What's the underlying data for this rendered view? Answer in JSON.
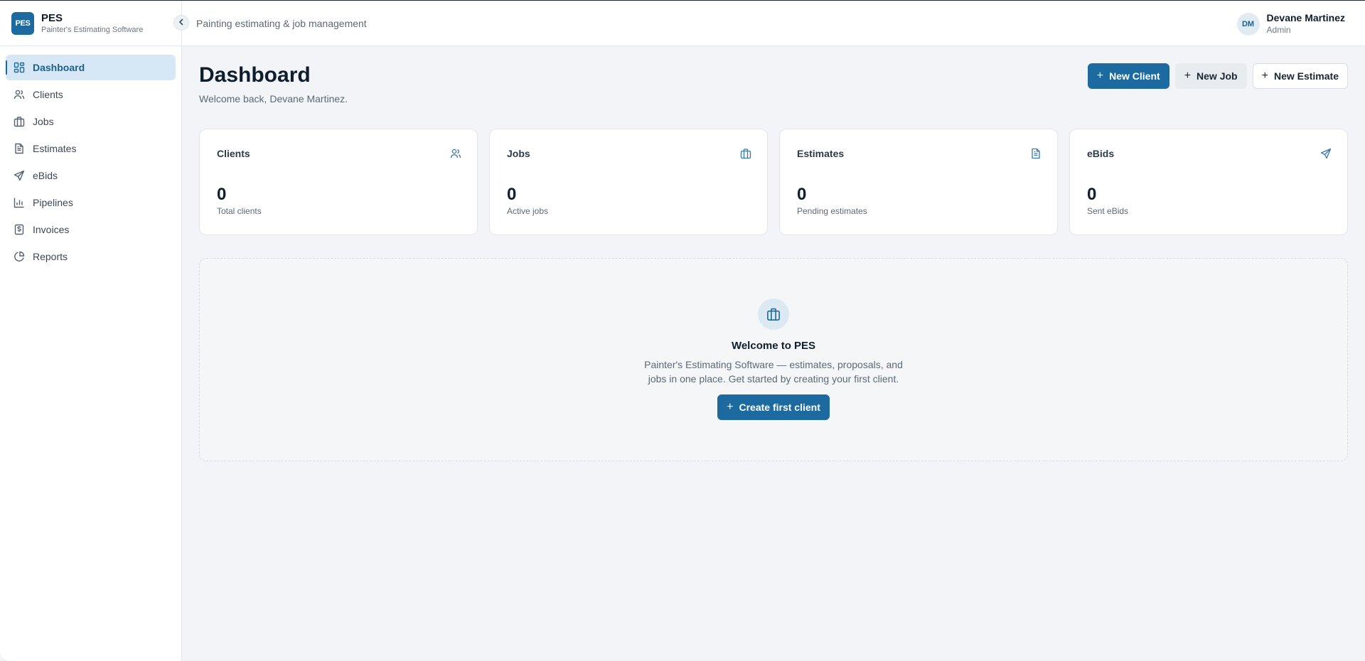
{
  "brand": {
    "logo_text": "PES",
    "name": "PES",
    "subtitle": "Painter's Estimating Software"
  },
  "sidebar": {
    "items": [
      {
        "label": "Dashboard",
        "icon": "dashboard-icon",
        "active": true
      },
      {
        "label": "Clients",
        "icon": "users-icon"
      },
      {
        "label": "Jobs",
        "icon": "briefcase-icon"
      },
      {
        "label": "Estimates",
        "icon": "document-icon"
      },
      {
        "label": "eBids",
        "icon": "send-icon"
      },
      {
        "label": "Pipelines",
        "icon": "bar-chart-icon"
      },
      {
        "label": "Invoices",
        "icon": "dollar-receipt-icon"
      },
      {
        "label": "Reports",
        "icon": "pie-chart-icon"
      }
    ]
  },
  "topbar": {
    "tagline": "Painting estimating & job management",
    "user": {
      "initials": "DM",
      "name": "Devane Martinez",
      "role": "Admin"
    }
  },
  "page": {
    "title": "Dashboard",
    "subtitle": "Welcome back, Devane Martinez."
  },
  "actions": {
    "new_client": "New Client",
    "new_job": "New Job",
    "new_estimate": "New Estimate"
  },
  "cards": [
    {
      "title": "Clients",
      "value": "0",
      "note": "Total clients",
      "icon": "users-icon"
    },
    {
      "title": "Jobs",
      "value": "0",
      "note": "Active jobs",
      "icon": "briefcase-icon"
    },
    {
      "title": "Estimates",
      "value": "0",
      "note": "Pending estimates",
      "icon": "document-icon"
    },
    {
      "title": "eBids",
      "value": "0",
      "note": "Sent eBids",
      "icon": "send-icon"
    }
  ],
  "welcome": {
    "title": "Welcome to PES",
    "text": "Painter's Estimating Software — estimates, proposals, and jobs in one place. Get started by creating your first client.",
    "button": "Create first client"
  },
  "colors": {
    "primary": "#1c6aa0",
    "active_bg": "#d6e8f5",
    "page_bg": "#f2f4f7"
  }
}
